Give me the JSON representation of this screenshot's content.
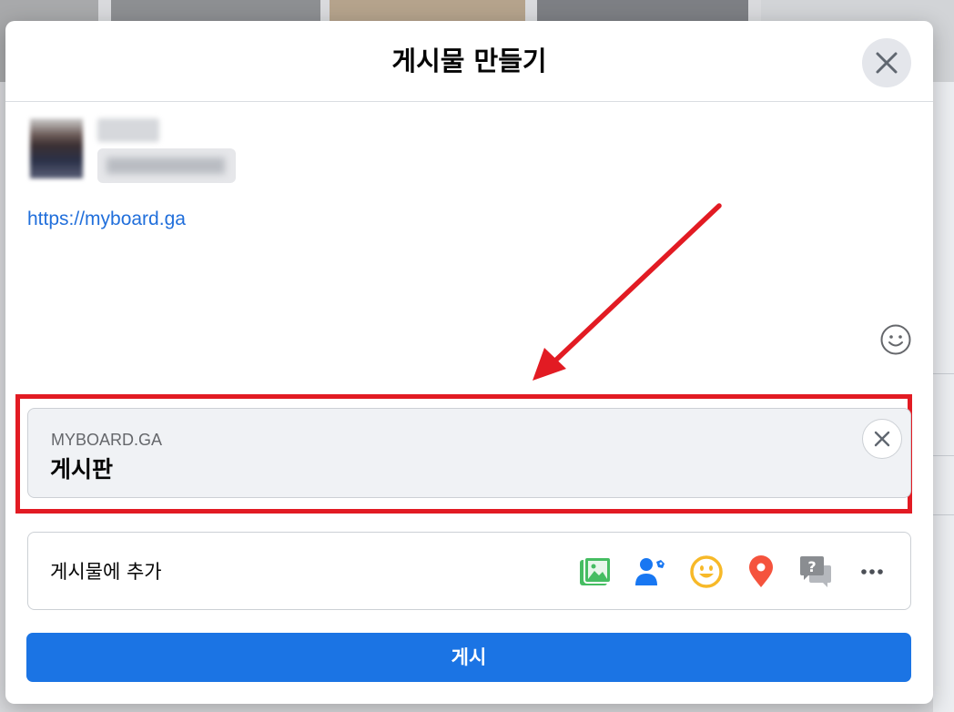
{
  "dialog": {
    "title": "게시물 만들기"
  },
  "composer": {
    "text": "https://myboard.ga"
  },
  "link_preview": {
    "domain": "MYBOARD.GA",
    "title": "게시판"
  },
  "add_to_post": {
    "label": "게시물에 추가",
    "icons": [
      "photo-video-icon",
      "tag-people-icon",
      "feeling-icon",
      "check-in-icon",
      "qa-icon",
      "more-icon"
    ]
  },
  "post_button": {
    "label": "게시"
  },
  "colors": {
    "accent": "#1b74e4",
    "highlight": "#e21b23",
    "link": "#216fdb"
  }
}
